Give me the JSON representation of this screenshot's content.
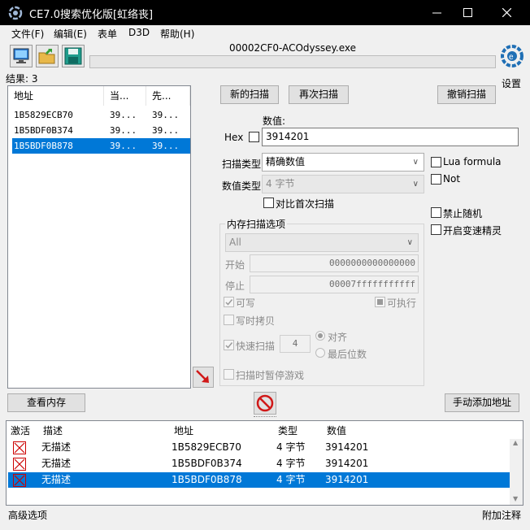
{
  "window": {
    "title": "CE7.0搜索优化版[虹络丧]",
    "minimize_icon": "minimize-icon",
    "maximize_icon": "maximize-icon",
    "close_icon": "close-icon"
  },
  "menu": [
    "文件(F)",
    "编辑(E)",
    "表单",
    "D3D",
    "帮助(H)"
  ],
  "toolbar": {
    "process_name": "00002CF0-ACOdyssey.exe",
    "settings_label": "设置"
  },
  "results": {
    "count_label": "结果: 3",
    "columns": [
      "地址",
      "当...",
      "先..."
    ],
    "rows": [
      {
        "address": "1B5829ECB70",
        "current": "39...",
        "previous": "39...",
        "selected": false
      },
      {
        "address": "1B5BDF0B374",
        "current": "39...",
        "previous": "39...",
        "selected": false
      },
      {
        "address": "1B5BDF0B878",
        "current": "39...",
        "previous": "39...",
        "selected": true
      }
    ]
  },
  "scan": {
    "new_scan": "新的扫描",
    "next_scan": "再次扫描",
    "undo_scan": "撤销扫描",
    "value_label": "数值:",
    "hex_label": "Hex",
    "value": "3914201",
    "scan_type_label": "扫描类型",
    "scan_type": "精确数值",
    "value_type_label": "数值类型",
    "value_type": "4 字节",
    "compare_first": "对比首次扫描",
    "lua_formula": "Lua formula",
    "not_label": "Not",
    "disable_random": "禁止随机",
    "speedhack": "开启变速精灵"
  },
  "memory_options": {
    "title": "内存扫描选项",
    "region": "All",
    "start_label": "开始",
    "start_value": "0000000000000000",
    "stop_label": "停止",
    "stop_value": "00007fffffffffff",
    "writable": "可写",
    "executable": "可执行",
    "copy_on_write": "写时拷贝",
    "fast_scan": "快速扫描",
    "fast_scan_value": "4",
    "alignment": "对齐",
    "last_digits": "最后位数",
    "pause_game": "扫描时暂停游戏"
  },
  "bottom": {
    "view_memory": "查看内存",
    "add_address": "手动添加地址"
  },
  "address_list": {
    "columns": [
      "激活",
      "描述",
      "地址",
      "类型",
      "数值"
    ],
    "rows": [
      {
        "description": "无描述",
        "address": "1B5829ECB70",
        "type": "4 字节",
        "value": "3914201",
        "selected": false
      },
      {
        "description": "无描述",
        "address": "1B5BDF0B374",
        "type": "4 字节",
        "value": "3914201",
        "selected": false
      },
      {
        "description": "无描述",
        "address": "1B5BDF0B878",
        "type": "4 字节",
        "value": "3914201",
        "selected": true
      }
    ]
  },
  "status": {
    "advanced": "高级选项",
    "comments": "附加注释"
  }
}
